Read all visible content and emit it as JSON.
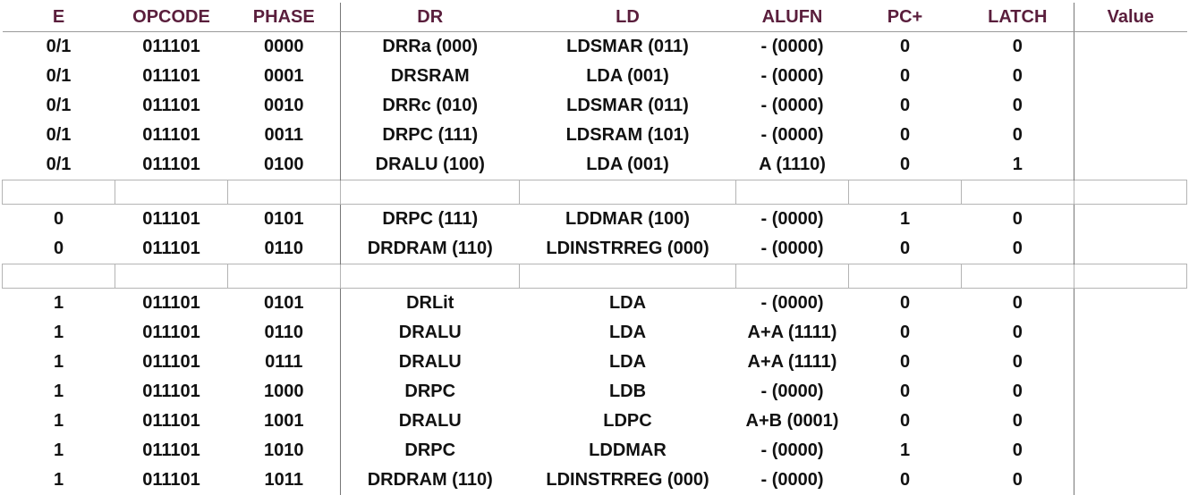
{
  "headers": [
    "E",
    "OPCODE",
    "PHASE",
    "DR",
    "LD",
    "ALUFN",
    "PC+",
    "LATCH",
    "Value"
  ],
  "groups": [
    {
      "rows": [
        [
          "0/1",
          "011101",
          "0000",
          "DRRa (000)",
          "LDSMAR (011)",
          "- (0000)",
          "0",
          "0",
          ""
        ],
        [
          "0/1",
          "011101",
          "0001",
          "DRSRAM",
          "LDA (001)",
          "- (0000)",
          "0",
          "0",
          ""
        ],
        [
          "0/1",
          "011101",
          "0010",
          "DRRc (010)",
          "LDSMAR (011)",
          "- (0000)",
          "0",
          "0",
          ""
        ],
        [
          "0/1",
          "011101",
          "0011",
          "DRPC (111)",
          "LDSRAM (101)",
          "- (0000)",
          "0",
          "0",
          ""
        ],
        [
          "0/1",
          "011101",
          "0100",
          "DRALU (100)",
          "LDA (001)",
          "A (1110)",
          "0",
          "1",
          ""
        ]
      ]
    },
    {
      "rows": [
        [
          "0",
          "011101",
          "0101",
          "DRPC (111)",
          "LDDMAR (100)",
          "- (0000)",
          "1",
          "0",
          ""
        ],
        [
          "0",
          "011101",
          "0110",
          "DRDRAM (110)",
          "LDINSTRREG (000)",
          "- (0000)",
          "0",
          "0",
          ""
        ]
      ]
    },
    {
      "rows": [
        [
          "1",
          "011101",
          "0101",
          "DRLit",
          "LDA",
          "- (0000)",
          "0",
          "0",
          ""
        ],
        [
          "1",
          "011101",
          "0110",
          "DRALU",
          "LDA",
          "A+A (1111)",
          "0",
          "0",
          ""
        ],
        [
          "1",
          "011101",
          "0111",
          "DRALU",
          "LDA",
          "A+A (1111)",
          "0",
          "0",
          ""
        ],
        [
          "1",
          "011101",
          "1000",
          "DRPC",
          "LDB",
          "- (0000)",
          "0",
          "0",
          ""
        ],
        [
          "1",
          "011101",
          "1001",
          "DRALU",
          "LDPC",
          "A+B (0001)",
          "0",
          "0",
          ""
        ],
        [
          "1",
          "011101",
          "1010",
          "DRPC",
          "LDDMAR",
          "- (0000)",
          "1",
          "0",
          ""
        ],
        [
          "1",
          "011101",
          "1011",
          "DRDRAM (110)",
          "LDINSTRREG (000)",
          "- (0000)",
          "0",
          "0",
          ""
        ]
      ]
    }
  ]
}
